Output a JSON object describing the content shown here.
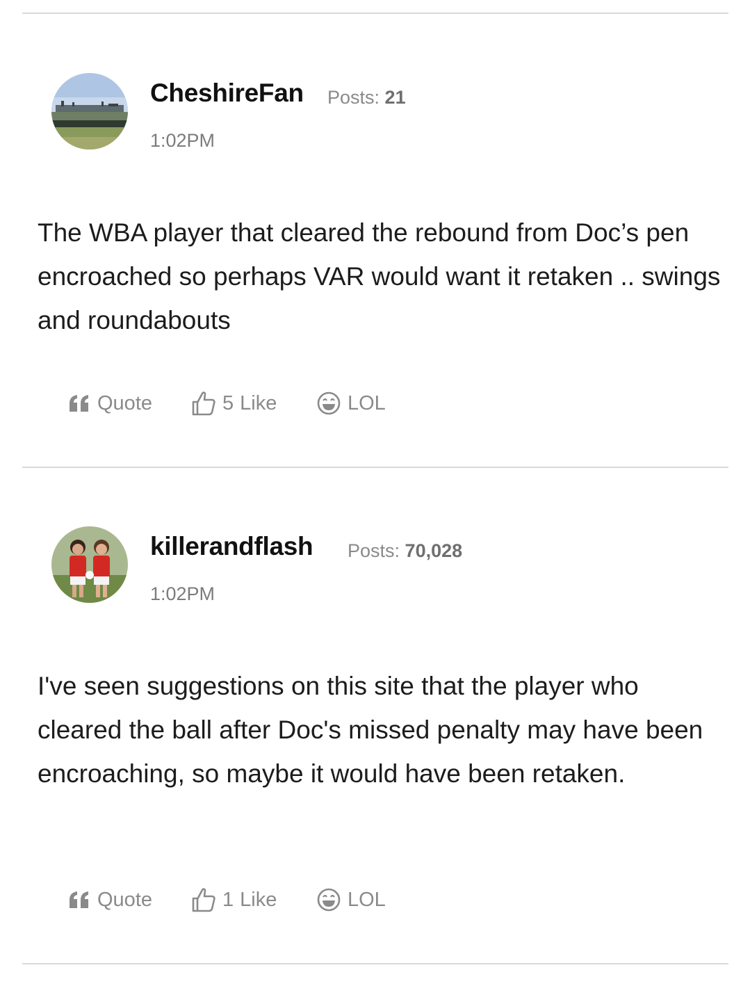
{
  "posts": [
    {
      "author": "CheshireFan",
      "posts_label": "Posts:",
      "posts_count": "21",
      "time": "1:02PM",
      "body": "The WBA player that cleared the rebound from Doc’s pen encroached so perhaps VAR would want it retaken .. swings and roundabouts",
      "avatar_icon": "stadium-photo-avatar",
      "actions": {
        "quote": "Quote",
        "like_count": "5",
        "like": "Like",
        "lol": "LOL"
      }
    },
    {
      "author": "killerandflash",
      "posts_label": "Posts:",
      "posts_count": "70,028",
      "time": "1:02PM",
      "body": "I've seen suggestions on this site that the player who cleared the ball after Doc's missed penalty may have been encroaching, so maybe it would have been retaken.",
      "avatar_icon": "two-footballers-photo-avatar",
      "actions": {
        "quote": "Quote",
        "like_count": "1",
        "like": "Like",
        "lol": "LOL"
      }
    }
  ],
  "icons": {
    "quote": "quote-icon",
    "like": "thumbs-up-icon",
    "lol": "laughing-face-icon"
  },
  "colors": {
    "divider": "#d9d9d9",
    "meta_text": "#8a8a8a",
    "author_text": "#111111"
  }
}
